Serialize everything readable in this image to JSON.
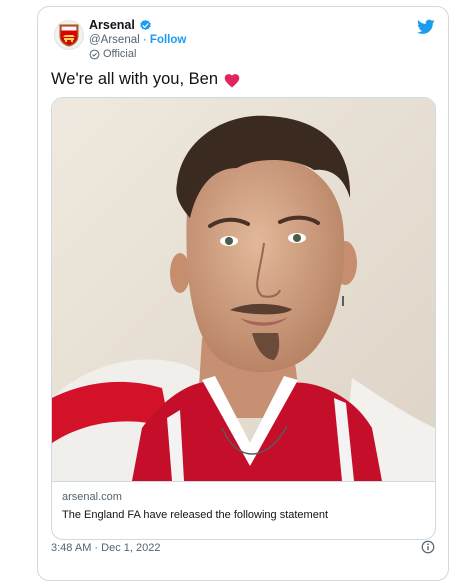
{
  "account": {
    "name": "Arsenal",
    "handle": "@Arsenal",
    "separator": "·",
    "follow_label": "Follow",
    "label": "Official",
    "avatar_icon": "arsenal-crest-icon"
  },
  "tweet": {
    "text": "We're all with you, Ben",
    "emoji_icon": "red-heart-icon"
  },
  "link_card": {
    "domain": "arsenal.com",
    "title": "The England FA have released the following statement",
    "image_icon": "player-portrait-photo"
  },
  "meta": {
    "timestamp": "3:48 AM · Dec 1, 2022",
    "info_icon": "info-icon",
    "platform_icon": "twitter-bird-icon"
  },
  "colors": {
    "brand_red": "#db0007",
    "twitter_blue": "#1d9bf0",
    "text_secondary": "#536471",
    "heart": "#e0245e"
  }
}
